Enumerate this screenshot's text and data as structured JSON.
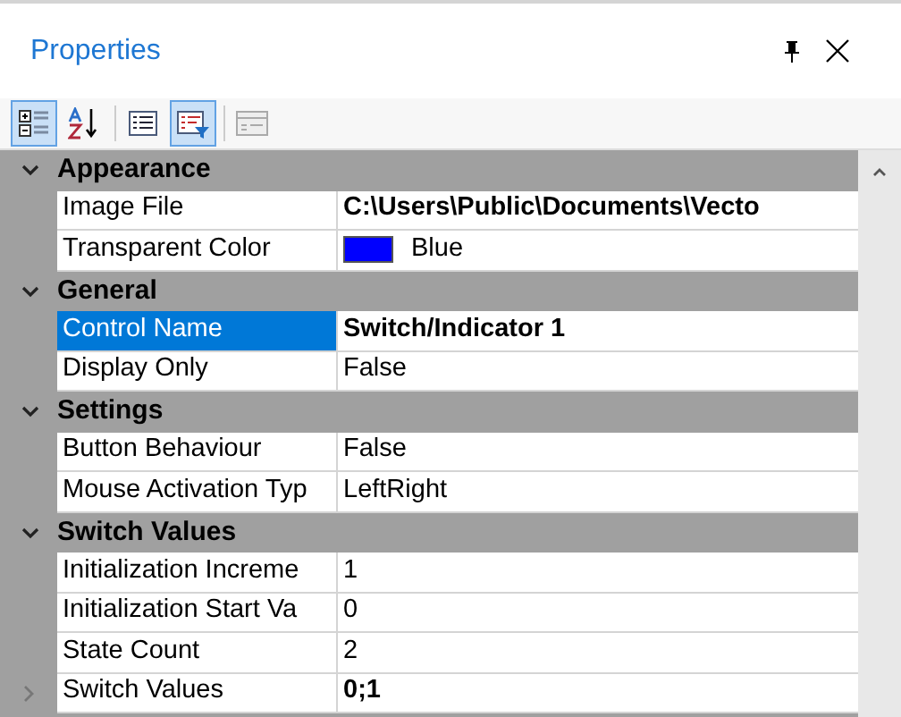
{
  "panel": {
    "title": "Properties"
  },
  "toolbar": [
    {
      "kind": "categorized",
      "selected": true
    },
    {
      "kind": "alphabetical",
      "selected": false
    },
    {
      "kind": "property-pages",
      "selected": false
    },
    {
      "kind": "events",
      "selected": true
    },
    {
      "kind": "disabled-pages",
      "selected": false
    }
  ],
  "categories": [
    {
      "name": "Appearance",
      "expanded": true,
      "properties": [
        {
          "name": "Image File",
          "value": "C:\\Users\\Public\\Documents\\Vecto",
          "bold": true,
          "selected": false,
          "expandable": false
        },
        {
          "name": "Transparent Color",
          "value": "Blue",
          "bold": false,
          "selected": false,
          "expandable": false,
          "color": "#0000ff"
        }
      ]
    },
    {
      "name": "General",
      "expanded": true,
      "properties": [
        {
          "name": "Control Name",
          "value": "Switch/Indicator 1",
          "bold": true,
          "selected": true,
          "expandable": false
        },
        {
          "name": "Display Only",
          "value": "False",
          "bold": false,
          "selected": false,
          "expandable": false
        }
      ]
    },
    {
      "name": "Settings",
      "expanded": true,
      "properties": [
        {
          "name": "Button Behaviour",
          "value": "False",
          "bold": false,
          "selected": false,
          "expandable": false
        },
        {
          "name": "Mouse Activation Typ",
          "value": "LeftRight",
          "bold": false,
          "selected": false,
          "expandable": false
        }
      ]
    },
    {
      "name": "Switch Values",
      "expanded": true,
      "properties": [
        {
          "name": "Initialization Increme",
          "value": "1",
          "bold": false,
          "selected": false,
          "expandable": false
        },
        {
          "name": "Initialization Start Va",
          "value": "0",
          "bold": false,
          "selected": false,
          "expandable": false
        },
        {
          "name": "State Count",
          "value": "2",
          "bold": false,
          "selected": false,
          "expandable": false
        },
        {
          "name": "Switch Values",
          "value": "0;1",
          "bold": true,
          "selected": false,
          "expandable": true
        }
      ]
    }
  ]
}
